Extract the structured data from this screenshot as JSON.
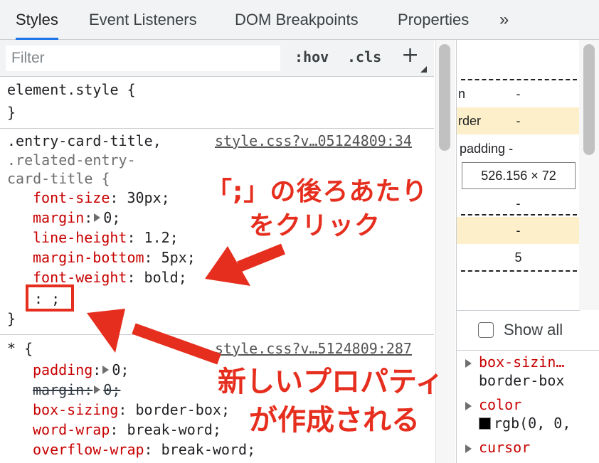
{
  "tabs": [
    {
      "label": "Styles",
      "active": true
    },
    {
      "label": "Event Listeners",
      "active": false
    },
    {
      "label": "DOM Breakpoints",
      "active": false
    },
    {
      "label": "Properties",
      "active": false
    }
  ],
  "tab_more": "»",
  "filter": {
    "placeholder": "Filter",
    "value": ""
  },
  "toolbar": {
    "hov": ":hov",
    "cls": ".cls",
    "add": "+"
  },
  "rules": {
    "element_style": {
      "open": "element.style {",
      "close": "}"
    },
    "entry": {
      "selector1": ".entry-card-title,",
      "selector2": ".related-entry-",
      "selector3": "card-title {",
      "source": "style.css?v…05124809:34",
      "decls": [
        {
          "name": "font-size",
          "value": "30px"
        },
        {
          "name": "margin",
          "value": "0"
        },
        {
          "name": "line-height",
          "value": "1.2"
        },
        {
          "name": "margin-bottom",
          "value": "5px"
        },
        {
          "name": "font-weight",
          "value": "bold"
        }
      ],
      "new_prop": ": ;",
      "close": "}"
    },
    "universal": {
      "selector": "* {",
      "source": "style.css?v…5124809:287",
      "decls": [
        {
          "name": "padding",
          "value": "0"
        },
        {
          "name": "margin",
          "value": "0"
        },
        {
          "name": "box-sizing",
          "value": "border-box"
        },
        {
          "name": "word-wrap",
          "value": "break-word"
        },
        {
          "name": "overflow-wrap",
          "value": "break-word"
        }
      ]
    }
  },
  "box_model": {
    "margin_label": "n",
    "margin_value": "-",
    "border_label": "rder",
    "border_value": "-",
    "padding_label": "padding -",
    "content": "526.156 × 72",
    "padding_bottom": "-",
    "border_bottom": "-",
    "margin_bottom": "5"
  },
  "show_all": {
    "label": "Show all",
    "checked": false
  },
  "computed": [
    {
      "name": "box-sizin…",
      "value": "border-box"
    },
    {
      "name": "color",
      "value": "rgb(0, 0,"
    },
    {
      "name": "cursor",
      "value": ""
    }
  ],
  "colors": {
    "accent": "#1a73e8",
    "annotation": "#e62e1e",
    "property": "#c80000",
    "box_model_border": "#fdefc9"
  },
  "annotations": {
    "click_line1": "「;」の後ろあたり",
    "click_line2": "をクリック",
    "new_line1": "新しいプロパティ",
    "new_line2": "が作成される"
  }
}
